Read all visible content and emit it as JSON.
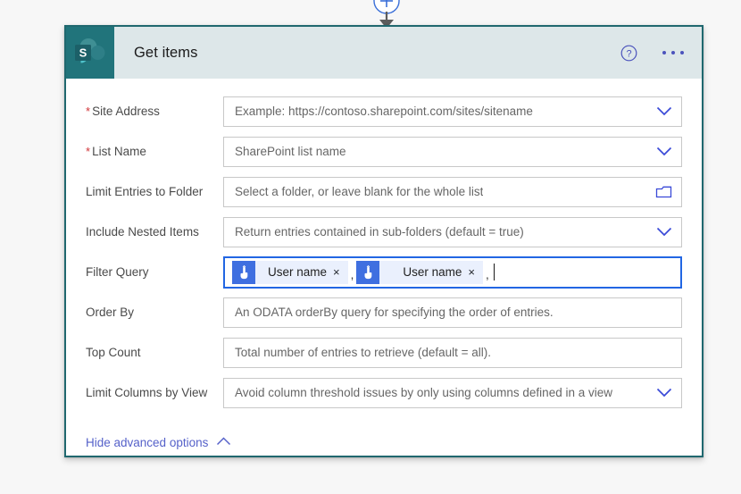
{
  "connector": {
    "add_button_label": "+",
    "add_icon": "plus-circle-icon",
    "arrow_icon": "arrow-down-icon"
  },
  "card": {
    "title": "Get items",
    "app_icon": "sharepoint-icon",
    "help_icon": "help-circle-icon",
    "more_icon": "ellipsis-icon",
    "accent_color": "#20686f",
    "header_bg": "#dde7e9",
    "logo_bg": "#21747b"
  },
  "fields": [
    {
      "label": "Site Address",
      "required": true,
      "placeholder": "Example: https://contoso.sharepoint.com/sites/sitename",
      "control": "dropdown",
      "icon": "chevron-down-icon"
    },
    {
      "label": "List Name",
      "required": true,
      "placeholder": "SharePoint list name",
      "control": "dropdown",
      "icon": "chevron-down-icon"
    },
    {
      "label": "Limit Entries to Folder",
      "required": false,
      "placeholder": "Select a folder, or leave blank for the whole list",
      "control": "folder-picker",
      "icon": "folder-icon"
    },
    {
      "label": "Include Nested Items",
      "required": false,
      "placeholder": "Return entries contained in sub-folders (default = true)",
      "control": "dropdown",
      "icon": "chevron-down-icon"
    },
    {
      "label": "Filter Query",
      "required": false,
      "placeholder": "",
      "control": "token-input",
      "icon": ""
    },
    {
      "label": "Order By",
      "required": false,
      "placeholder": "An ODATA orderBy query for specifying the order of entries.",
      "control": "text",
      "icon": ""
    },
    {
      "label": "Top Count",
      "required": false,
      "placeholder": "Total number of entries to retrieve (default = all).",
      "control": "text",
      "icon": ""
    },
    {
      "label": "Limit Columns by View",
      "required": false,
      "placeholder": "Avoid column threshold issues by only using columns defined in a view",
      "control": "dropdown",
      "icon": "chevron-down-icon"
    }
  ],
  "filter_query": {
    "tokens": [
      {
        "label": "User name",
        "icon": "touch-pointer-icon",
        "remove": "×"
      },
      {
        "label": "User name",
        "icon": "touch-pointer-icon",
        "remove": "×"
      }
    ],
    "separator": ",",
    "trailing_text": ","
  },
  "footer": {
    "advanced_toggle_label": "Hide advanced options",
    "advanced_toggle_icon": "chevron-up-icon"
  },
  "required_marker": "*"
}
